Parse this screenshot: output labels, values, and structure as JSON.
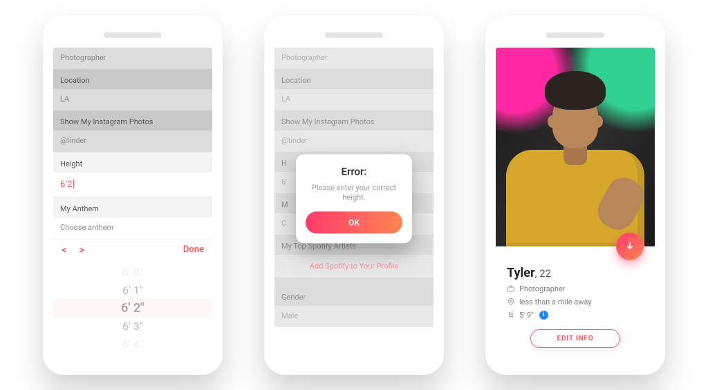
{
  "phone1": {
    "field_job_label": "Photographer",
    "location_label": "Location",
    "location_value": "LA",
    "instagram_label": "Show My Instagram Photos",
    "instagram_value": "@tinder",
    "height_label": "Height",
    "height_value": "6'2",
    "anthem_label": "My Anthem",
    "anthem_placeholder": "Choose anthem",
    "picker": {
      "done": "Done",
      "options": [
        "6' 0\"",
        "6' 1\"",
        "6' 2\"",
        "6' 3\"",
        "6' 4\""
      ],
      "selected_index": 2
    }
  },
  "phone2": {
    "field_job_label": "Photographer",
    "location_label": "Location",
    "location_value": "LA",
    "instagram_label": "Show My Instagram Photos",
    "instagram_value": "@tinder",
    "height_label": "H",
    "height_value": "6'",
    "anthem_label": "M",
    "anthem_placeholder": "C",
    "spotify_artists_label": "My Top Spotify Artists",
    "spotify_link": "Add Spotify to Your Profile",
    "gender_label": "Gender",
    "gender_value": "Male",
    "modal": {
      "title": "Error:",
      "body": "Please enter your correct height.",
      "ok": "OK"
    }
  },
  "profile": {
    "name": "Tyler",
    "age": "22",
    "job": "Photographer",
    "distance": "less than a mile away",
    "height": "5' 9\"",
    "edit_label": "EDIT INFO"
  }
}
